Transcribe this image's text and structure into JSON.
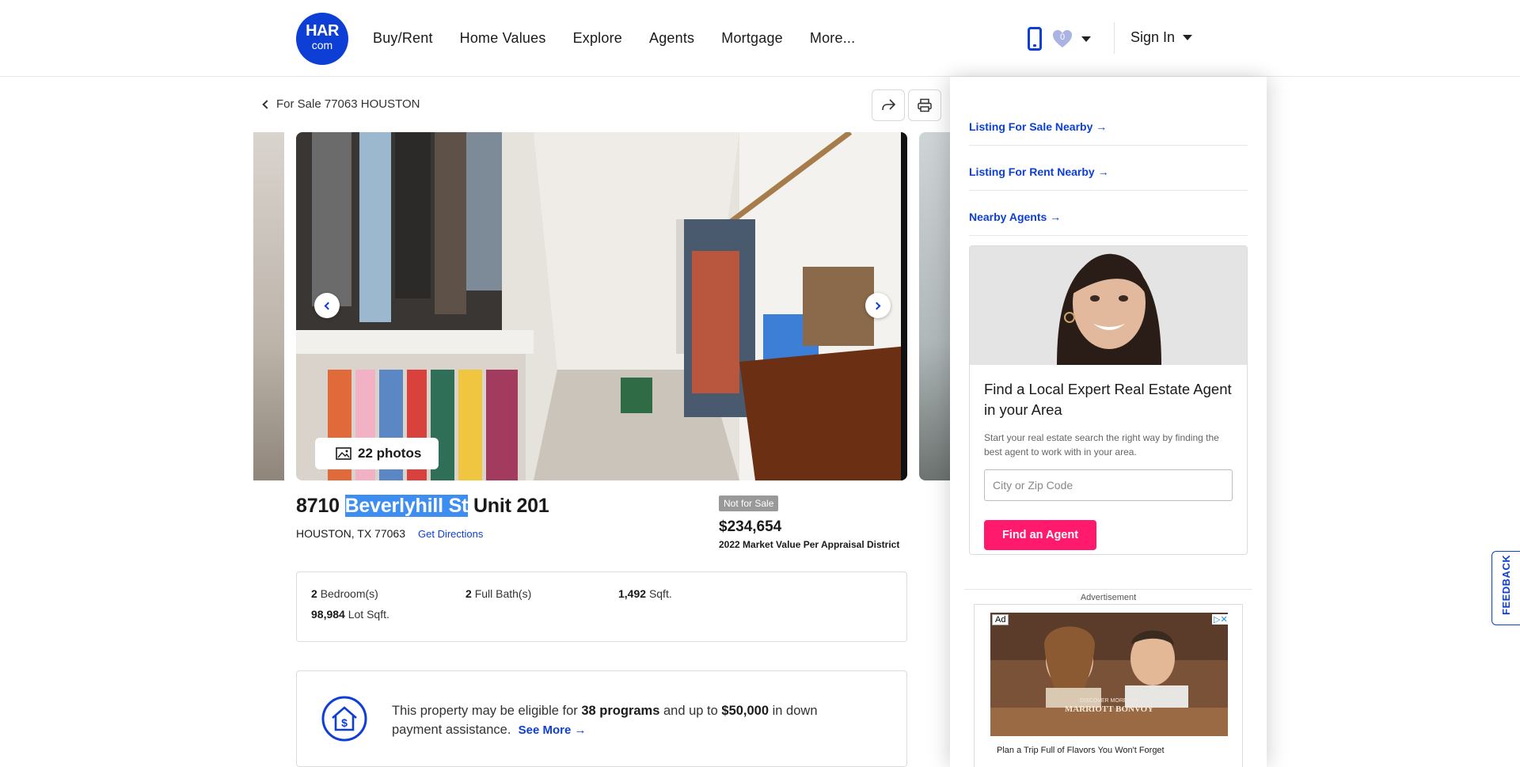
{
  "header": {
    "logo_line1": "HAR",
    "logo_line2": "com",
    "nav": [
      "Buy/Rent",
      "Home Values",
      "Explore",
      "Agents",
      "Mortgage",
      "More..."
    ],
    "favorites_count": "0",
    "signin_label": "Sign In",
    "brand_color": "#0d3fd6"
  },
  "breadcrumb": {
    "back_label": "For Sale 77063 HOUSTON"
  },
  "gallery": {
    "photos_label": "22 photos"
  },
  "listing": {
    "address_number": "8710",
    "address_street": "Beverlyhill St",
    "address_unit": "Unit 201",
    "city_line": "HOUSTON, TX 77063",
    "directions_label": "Get Directions",
    "status_badge": "Not for Sale",
    "price": "$234,654",
    "price_note": "2022 Market Value Per Appraisal District"
  },
  "facts": {
    "bedrooms_value": "2",
    "bedrooms_label": "Bedroom(s)",
    "baths_value": "2",
    "baths_label": "Full Bath(s)",
    "sqft_value": "1,492",
    "sqft_label": "Sqft.",
    "lot_value": "98,984",
    "lot_label": "Lot Sqft."
  },
  "programs": {
    "text_a": "This property may be eligible for ",
    "count": "38 programs",
    "text_b": " and up to ",
    "amount": "$50,000",
    "text_c": " in down payment assistance.",
    "see_more": "See More →"
  },
  "sidebar": {
    "links": [
      "Listing For Sale Nearby →",
      "Listing For Rent Nearby →",
      "Nearby Agents →"
    ],
    "agent_title": "Find a Local Expert Real Estate Agent in your Area",
    "agent_desc": "Start your real estate search the right way by finding the best agent to work with in your area.",
    "agent_placeholder": "City or Zip Code",
    "agent_button": "Find an Agent",
    "ad_label": "Advertisement",
    "ad_tag": "Ad",
    "ad_close": "▷✕",
    "ad_brand": "MARRIOTT BONVOY",
    "ad_brand_sub": "DISCOVER MORE with",
    "ad_caption": "Plan a Trip Full of Flavors You Won't Forget",
    "cta_color": "#ff1a6e"
  },
  "feedback_label": "FEEDBACK"
}
